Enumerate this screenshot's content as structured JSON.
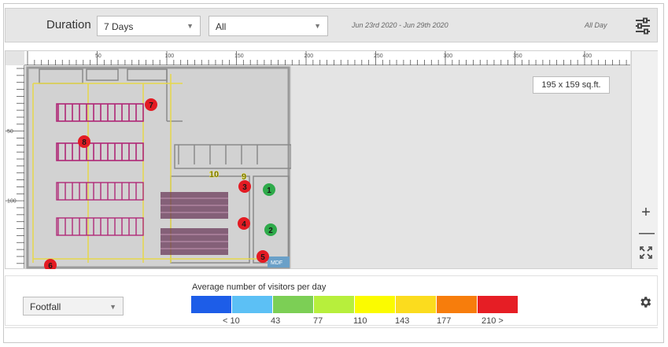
{
  "filters": {
    "duration_label": "Duration",
    "duration_value": "7 Days",
    "area_value": "All",
    "date_range": "Jun 23rd 2020 - Jun 29th 2020",
    "time_of_day": "All Day"
  },
  "map": {
    "ruler_top_labels": [
      "50",
      "100",
      "150",
      "200",
      "250",
      "300",
      "350",
      "400"
    ],
    "ruler_left_labels": [
      "50",
      "100"
    ],
    "dimensions": "195 x 159 sq.ft.",
    "zones": [
      {
        "label": "1",
        "color": "#2eaa4a"
      },
      {
        "label": "2",
        "color": "#2eaa4a"
      },
      {
        "label": "3",
        "color": "#e31b23"
      },
      {
        "label": "4",
        "color": "#e31b23"
      },
      {
        "label": "5",
        "color": "#e31b23"
      },
      {
        "label": "6",
        "color": "#e31b23"
      },
      {
        "label": "7",
        "color": "#e31b23"
      },
      {
        "label": "8",
        "color": "#e31b23"
      },
      {
        "label": "9",
        "color": "#e8e02a"
      },
      {
        "label": "10",
        "color": "#e8e02a"
      }
    ],
    "plan_label": "MDF"
  },
  "legend": {
    "metric_value": "Footfall",
    "title": "Average number of visitors per day",
    "colors": [
      "#1d5de8",
      "#5cc0f5",
      "#7ccf55",
      "#b7ef3c",
      "#fbfb00",
      "#fbdc1e",
      "#f77d0c",
      "#e61e25"
    ],
    "labels": [
      "< 10",
      "43",
      "77",
      "110",
      "143",
      "177",
      "210 >"
    ]
  }
}
